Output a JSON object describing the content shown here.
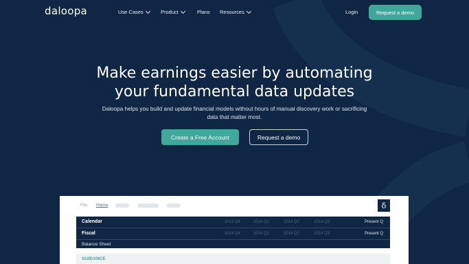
{
  "brand": {
    "logo_text": "daloopa"
  },
  "nav": {
    "items": [
      {
        "label": "Use Cases",
        "has_dropdown": true
      },
      {
        "label": "Product",
        "has_dropdown": true
      },
      {
        "label": "Plans",
        "has_dropdown": false
      },
      {
        "label": "Resources",
        "has_dropdown": true
      }
    ],
    "login": "Login",
    "cta": "Request a demo"
  },
  "hero": {
    "title_line1": "Make earnings easier by automating",
    "title_line2": "your fundamental data updates",
    "subtitle": "Daloopa helps you build and update financial models without hours of manual discovery work or sacrificing data that matter most.",
    "primary_button": "Create a Free Account",
    "secondary_button": "Request a demo"
  },
  "app_preview": {
    "menu_file": "File",
    "menu_home": "Home",
    "logo_glyph": "δ",
    "rows": [
      {
        "label": "Calendar",
        "cols": [
          "2013 Q4",
          "2014 Q1",
          "2014 Q2",
          "2014 Q3"
        ],
        "present": "Present Q"
      },
      {
        "label": "Fiscal",
        "cols": [
          "2014 Q4",
          "2014 Q1",
          "2014 Q2",
          "2014 Q3"
        ],
        "present": "Present Q"
      }
    ],
    "sub_row": "Balance Sheet",
    "guidance": "GUIDANCE"
  },
  "colors": {
    "background": "#0f2744",
    "accent": "#3ea89a"
  }
}
